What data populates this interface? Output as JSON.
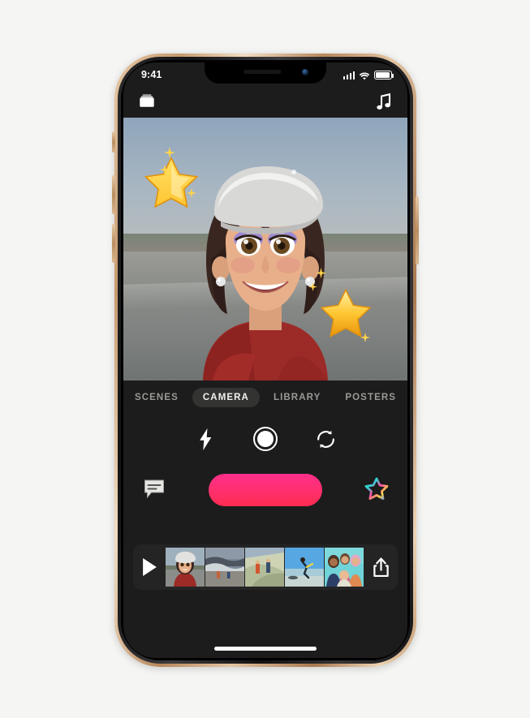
{
  "page": {
    "background_color": "#f5f5f3",
    "device": "iPhone XS Gold",
    "frame_color": "#c79a6d"
  },
  "status_bar": {
    "time": "9:41",
    "signal_icon": "cellular-bars-icon",
    "signal_bars": 4,
    "wifi_icon": "wifi-icon",
    "battery_icon": "battery-full-icon",
    "battery_level": 100
  },
  "app_nav": {
    "projects_icon": "projects-folder-icon",
    "music_icon": "music-note-icon"
  },
  "preview": {
    "name": "camera-preview",
    "subject": "memoji-selfie",
    "scene": "beach-sunset",
    "hat": "white-beret",
    "shirt_color": "#9c2a26",
    "stickers": [
      "star-sticker-top-left",
      "star-sticker-bottom-right"
    ],
    "sparkles": 5
  },
  "tabs": {
    "selected": "CAMERA",
    "pill_color": "#333331",
    "items": [
      {
        "label": "SCENES",
        "name": "tab-scenes",
        "active": false
      },
      {
        "label": "CAMERA",
        "name": "tab-camera",
        "active": true
      },
      {
        "label": "LIBRARY",
        "name": "tab-library",
        "active": false
      },
      {
        "label": "POSTERS",
        "name": "tab-posters",
        "active": false
      }
    ]
  },
  "camera_controls": [
    {
      "name": "flash-icon",
      "label": "Flash"
    },
    {
      "name": "shutter-effects-icon",
      "label": "Effects"
    },
    {
      "name": "camera-flip-icon",
      "label": "Flip Camera"
    }
  ],
  "record_row": {
    "text_icon": "text-bubble-icon",
    "record_button": "record-button",
    "record_gradient_top": "#ff2d87",
    "record_gradient_bottom": "#ff2d55",
    "stickers_icon": "rainbow-star-icon"
  },
  "filmstrip": {
    "play_icon": "play-icon",
    "share_icon": "share-icon",
    "clips": [
      {
        "name": "clip-memoji-selfie",
        "label": "Memoji selfie on beach"
      },
      {
        "name": "clip-beach-waves",
        "label": "Beach waves at dusk"
      },
      {
        "name": "clip-dune-tent",
        "label": "Friends on dune"
      },
      {
        "name": "clip-beach-jump",
        "label": "Jumping on shoreline"
      },
      {
        "name": "clip-friends-group",
        "label": "Group of friends"
      }
    ]
  },
  "home_indicator": {
    "name": "home-indicator"
  }
}
